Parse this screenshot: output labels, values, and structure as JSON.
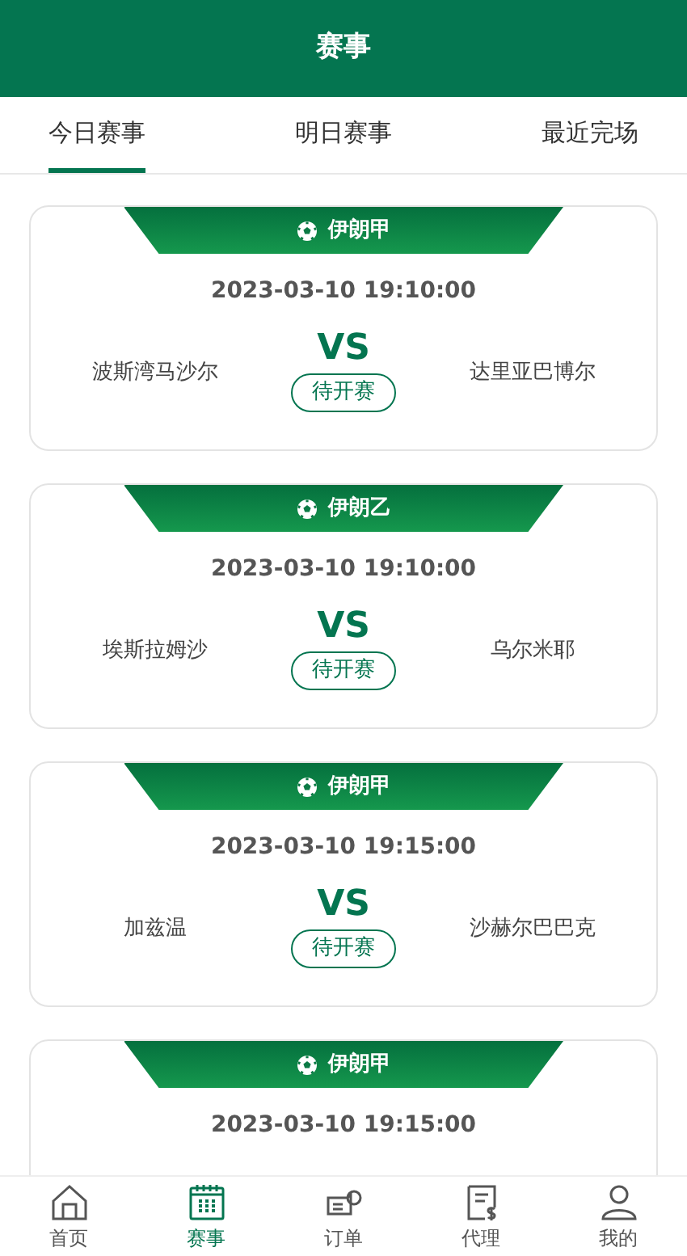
{
  "header": {
    "title": "赛事"
  },
  "tabs": [
    {
      "label": "今日赛事",
      "selected": true
    },
    {
      "label": "明日赛事",
      "selected": false
    },
    {
      "label": "最近完场",
      "selected": false
    }
  ],
  "matches": [
    {
      "league": "伊朗甲",
      "time": "2023-03-10 19:10:00",
      "home": "波斯湾马沙尔",
      "vs": "VS",
      "away": "达里亚巴博尔",
      "status": "待开赛"
    },
    {
      "league": "伊朗乙",
      "time": "2023-03-10 19:10:00",
      "home": "埃斯拉姆沙",
      "vs": "VS",
      "away": "乌尔米耶",
      "status": "待开赛"
    },
    {
      "league": "伊朗甲",
      "time": "2023-03-10 19:15:00",
      "home": "加兹温",
      "vs": "VS",
      "away": "沙赫尔巴巴克",
      "status": "待开赛"
    },
    {
      "league": "伊朗甲",
      "time": "2023-03-10 19:15:00"
    }
  ],
  "nav": [
    {
      "label": "首页",
      "selected": false
    },
    {
      "label": "赛事",
      "selected": true
    },
    {
      "label": "订单",
      "selected": false
    },
    {
      "label": "代理",
      "selected": false
    },
    {
      "label": "我的",
      "selected": false
    }
  ]
}
